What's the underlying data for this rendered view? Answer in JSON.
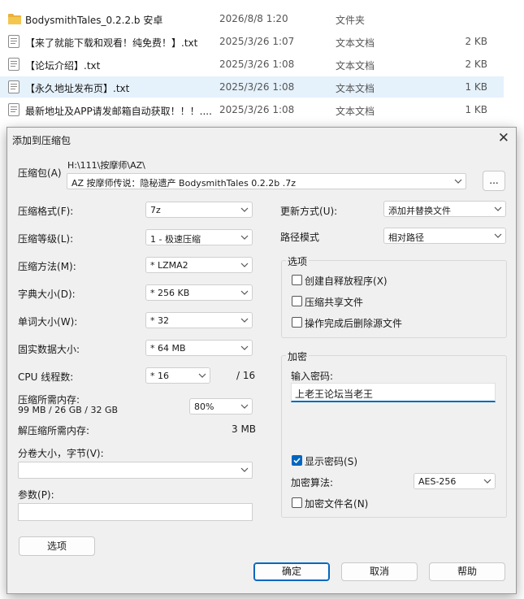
{
  "files": [
    {
      "name": "BodysmithTales_0.2.2.b 安卓",
      "date": "2026/8/8 1:20",
      "type": "文件夹",
      "size": "",
      "icon": "folder-icon"
    },
    {
      "name": "【来了就能下载和观看！纯免费！】.txt",
      "date": "2025/3/26 1:07",
      "type": "文本文档",
      "size": "2 KB",
      "icon": "text-file-icon"
    },
    {
      "name": "【论坛介绍】.txt",
      "date": "2025/3/26 1:08",
      "type": "文本文档",
      "size": "2 KB",
      "icon": "text-file-icon"
    },
    {
      "name": "【永久地址发布页】.txt",
      "date": "2025/3/26 1:08",
      "type": "文本文档",
      "size": "1 KB",
      "icon": "text-file-icon"
    },
    {
      "name": "最新地址及APP请发邮箱自动获取！！！....",
      "date": "2025/3/26 1:08",
      "type": "文本文档",
      "size": "1 KB",
      "icon": "text-file-icon"
    }
  ],
  "dialog": {
    "title": "添加到压缩包",
    "close": "✕",
    "archive": {
      "label": "压缩包",
      "hotkey": "(A)",
      "path": "H:\\111\\按摩师\\AZ\\",
      "value": "AZ 按摩师传说：隐秘遗产 BodysmithTales 0.2.2b .7z",
      "browse": "..."
    },
    "left": {
      "format_label": "压缩格式",
      "format_hotkey": "(F)",
      "format_value": "7z",
      "level_label": "压缩等级",
      "level_hotkey": "(L)",
      "level_value": "1 - 极速压缩",
      "method_label": "压缩方法",
      "method_hotkey": "(M)",
      "method_value": "*  LZMA2",
      "dict_label": "字典大小",
      "dict_hotkey": "(D)",
      "dict_value": "*  256 KB",
      "word_label": "单词大小",
      "word_hotkey": "(W)",
      "word_value": "*  32",
      "solid_label": "固实数据大小",
      "solid_hotkey": "",
      "solid_value": "*  64 MB",
      "cpu_label": "CPU 线程数",
      "cpu_value": "*  16",
      "cpu_total": "/ 16",
      "mem_label": "压缩所需内存:",
      "mem_detail": "99 MB / 26 GB / 32 GB",
      "mem_value": "80%",
      "decomp_label": "解压缩所需内存:",
      "decomp_value": "3 MB",
      "split_label": "分卷大小，字节",
      "split_hotkey": "(V)",
      "split_value": "",
      "params_label": "参数",
      "params_hotkey": "(P)",
      "params_value": "",
      "options_button": "选项"
    },
    "right": {
      "update_label": "更新方式",
      "update_hotkey": "(U)",
      "update_value": "添加并替换文件",
      "path_label": "路径模式",
      "path_value": "相对路径",
      "options_title": "选项",
      "sfx_label": "创建自释放程序",
      "sfx_hotkey": "(X)",
      "shared_label": "压缩共享文件",
      "delete_label": "操作完成后删除源文件",
      "encrypt_title": "加密",
      "pwd_label": "输入密码:",
      "pwd_value": "上老王论坛当老王",
      "show_pwd_label": "显示密码",
      "show_pwd_hotkey": "(S)",
      "method_label": "加密算法:",
      "method_value": "AES-256",
      "encrypt_names_label": "加密文件名",
      "encrypt_names_hotkey": "(N)"
    },
    "buttons": {
      "ok": "确定",
      "cancel": "取消",
      "help": "帮助"
    }
  },
  "colors": {
    "accent": "#0067c0",
    "selected_row": "#e5f1fb",
    "dialog_bg": "#f0f0f0",
    "folder": "#e8b23d"
  }
}
